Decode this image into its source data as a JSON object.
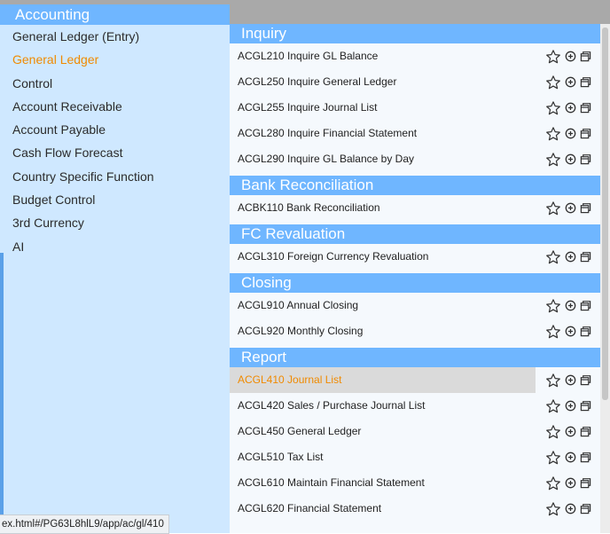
{
  "left_panel": {
    "title": "Accounting",
    "items": [
      {
        "label": "General Ledger (Entry)",
        "active": false
      },
      {
        "label": "General Ledger",
        "active": true
      },
      {
        "label": "Control",
        "active": false
      },
      {
        "label": "Account Receivable",
        "active": false
      },
      {
        "label": "Account Payable",
        "active": false
      },
      {
        "label": "Cash Flow Forecast",
        "active": false
      },
      {
        "label": "Country Specific Function",
        "active": false
      },
      {
        "label": "Budget Control",
        "active": false
      },
      {
        "label": "3rd Currency",
        "active": false
      },
      {
        "label": "AI",
        "active": false
      }
    ]
  },
  "sections": [
    {
      "title": "Inquiry",
      "entries": [
        {
          "label": "ACGL210 Inquire GL Balance"
        },
        {
          "label": "ACGL250 Inquire General Ledger"
        },
        {
          "label": "ACGL255 Inquire Journal List"
        },
        {
          "label": "ACGL280 Inquire Financial Statement"
        },
        {
          "label": "ACGL290 Inquire GL Balance by Day"
        }
      ]
    },
    {
      "title": "Bank Reconciliation",
      "entries": [
        {
          "label": "ACBK110 Bank Reconciliation"
        }
      ]
    },
    {
      "title": "FC Revaluation",
      "entries": [
        {
          "label": "ACGL310 Foreign Currency Revaluation"
        }
      ]
    },
    {
      "title": "Closing",
      "entries": [
        {
          "label": "ACGL910 Annual Closing"
        },
        {
          "label": "ACGL920 Monthly Closing"
        }
      ]
    },
    {
      "title": "Report",
      "entries": [
        {
          "label": "ACGL410 Journal List",
          "highlight": true
        },
        {
          "label": "ACGL420 Sales / Purchase Journal List"
        },
        {
          "label": "ACGL450 General Ledger"
        },
        {
          "label": "ACGL510 Tax List"
        },
        {
          "label": "ACGL610 Maintain Financial Statement"
        },
        {
          "label": "ACGL620 Financial Statement"
        }
      ]
    }
  ],
  "entry_icons": [
    "star-icon",
    "add-circle-icon",
    "new-window-icon"
  ],
  "status_url": "ex.html#/PG63L8hlL9/app/ac/gl/410",
  "colors": {
    "accent_blue": "#6fb6ff",
    "panel_blue": "#cfe8ff",
    "active_orange": "#f08a00",
    "highlight_gray": "#dadada"
  }
}
